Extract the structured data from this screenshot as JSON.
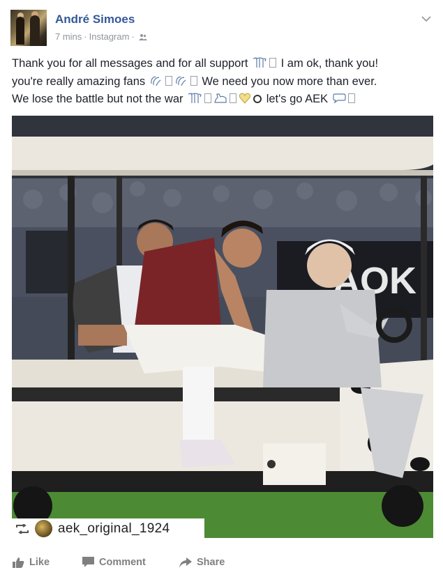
{
  "post": {
    "author": "André Simoes",
    "time": "7 mins",
    "source": "Instagram",
    "privacy_icon": "friends-icon",
    "menu_icon": "chevron-down-icon",
    "text": {
      "line1_a": "Thank you for all messages and for all support",
      "line1_b": "I am ok, thank you!",
      "line2_a": "you're really amazing fans",
      "line2_b": "We need you now more than ever.",
      "line3_a": "We lose the battle but not the war",
      "line3_b": "let's go AEK"
    },
    "photo": {
      "banner_text": "AOK"
    },
    "regram": {
      "icon": "repost-icon",
      "username": "aek_original_1924"
    }
  },
  "actions": {
    "like": "Like",
    "comment": "Comment",
    "share": "Share"
  },
  "colors": {
    "author_link": "#365899",
    "meta_gray": "#90949c",
    "action_gray": "#7f7f7f"
  }
}
